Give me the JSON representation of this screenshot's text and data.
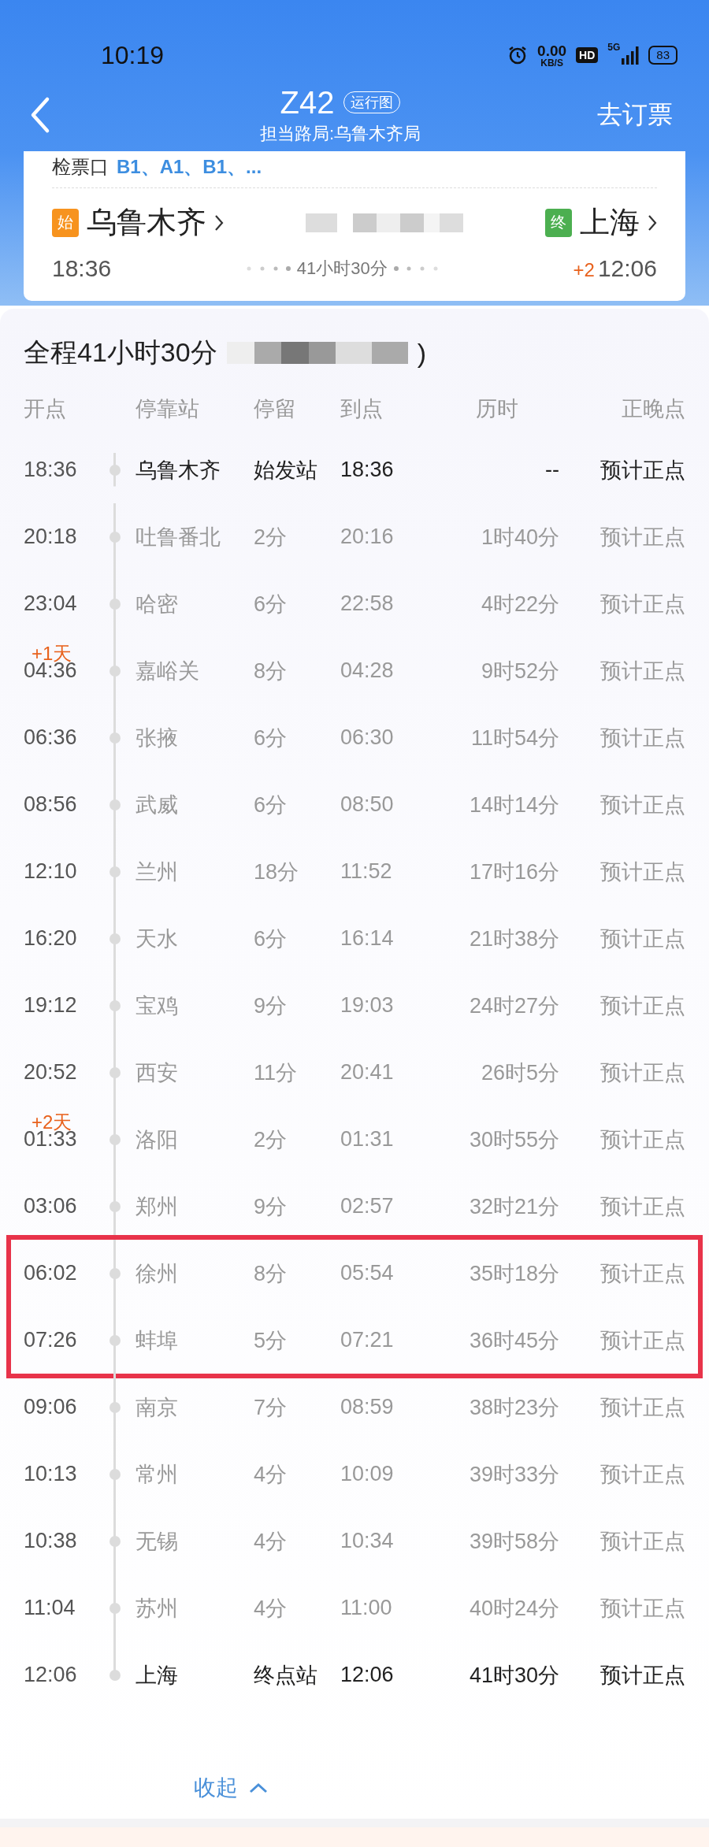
{
  "status_bar": {
    "time": "10:19",
    "speed": "0.00",
    "speed_unit": "KB/S",
    "hd": "HD",
    "network": "5G",
    "battery": "83"
  },
  "header": {
    "train": "Z42",
    "badge": "运行图",
    "subtitle": "担当路局:乌鲁木齐局",
    "action": "去订票"
  },
  "card": {
    "gate_label": "检票口",
    "gate_value": "B1、A1、B1、...",
    "origin": {
      "tag": "始",
      "station": "乌鲁木齐",
      "time": "18:36"
    },
    "terminal": {
      "tag": "终",
      "station": "上海",
      "time": "12:06",
      "day_offset": "+2"
    },
    "duration": "41小时30分"
  },
  "schedule": {
    "title": "全程41小时30分",
    "title_tail": ")",
    "columns": [
      "开点",
      "停靠站",
      "停留",
      "到点",
      "历时",
      "正晚点"
    ],
    "rows": [
      {
        "kind": "origin",
        "depart": "18:36",
        "station": "乌鲁木齐",
        "stop": "始发站",
        "arrive": "18:36",
        "elapsed": "--",
        "status": "预计正点",
        "highlighted": false
      },
      {
        "kind": "stop",
        "depart": "20:18",
        "station": "吐鲁番北",
        "stop": "2分",
        "arrive": "20:16",
        "elapsed": "1时40分",
        "status": "预计正点",
        "highlighted": false
      },
      {
        "kind": "stop",
        "depart": "23:04",
        "station": "哈密",
        "stop": "6分",
        "arrive": "22:58",
        "elapsed": "4时22分",
        "status": "预计正点",
        "highlighted": false
      },
      {
        "kind": "stop",
        "day_mark": "+1天",
        "depart": "04:36",
        "station": "嘉峪关",
        "stop": "8分",
        "arrive": "04:28",
        "elapsed": "9时52分",
        "status": "预计正点",
        "highlighted": false
      },
      {
        "kind": "stop",
        "depart": "06:36",
        "station": "张掖",
        "stop": "6分",
        "arrive": "06:30",
        "elapsed": "11时54分",
        "status": "预计正点",
        "highlighted": false
      },
      {
        "kind": "stop",
        "depart": "08:56",
        "station": "武威",
        "stop": "6分",
        "arrive": "08:50",
        "elapsed": "14时14分",
        "status": "预计正点",
        "highlighted": false
      },
      {
        "kind": "stop",
        "depart": "12:10",
        "station": "兰州",
        "stop": "18分",
        "arrive": "11:52",
        "elapsed": "17时16分",
        "status": "预计正点",
        "highlighted": false
      },
      {
        "kind": "stop",
        "depart": "16:20",
        "station": "天水",
        "stop": "6分",
        "arrive": "16:14",
        "elapsed": "21时38分",
        "status": "预计正点",
        "highlighted": false
      },
      {
        "kind": "stop",
        "depart": "19:12",
        "station": "宝鸡",
        "stop": "9分",
        "arrive": "19:03",
        "elapsed": "24时27分",
        "status": "预计正点",
        "highlighted": false
      },
      {
        "kind": "stop",
        "depart": "20:52",
        "station": "西安",
        "stop": "11分",
        "arrive": "20:41",
        "elapsed": "26时5分",
        "status": "预计正点",
        "highlighted": false
      },
      {
        "kind": "stop",
        "day_mark": "+2天",
        "depart": "01:33",
        "station": "洛阳",
        "stop": "2分",
        "arrive": "01:31",
        "elapsed": "30时55分",
        "status": "预计正点",
        "highlighted": false
      },
      {
        "kind": "stop",
        "depart": "03:06",
        "station": "郑州",
        "stop": "9分",
        "arrive": "02:57",
        "elapsed": "32时21分",
        "status": "预计正点",
        "highlighted": false
      },
      {
        "kind": "stop",
        "depart": "06:02",
        "station": "徐州",
        "stop": "8分",
        "arrive": "05:54",
        "elapsed": "35时18分",
        "status": "预计正点",
        "highlighted": true
      },
      {
        "kind": "stop",
        "depart": "07:26",
        "station": "蚌埠",
        "stop": "5分",
        "arrive": "07:21",
        "elapsed": "36时45分",
        "status": "预计正点",
        "highlighted": true
      },
      {
        "kind": "stop",
        "depart": "09:06",
        "station": "南京",
        "stop": "7分",
        "arrive": "08:59",
        "elapsed": "38时23分",
        "status": "预计正点",
        "highlighted": false
      },
      {
        "kind": "stop",
        "depart": "10:13",
        "station": "常州",
        "stop": "4分",
        "arrive": "10:09",
        "elapsed": "39时33分",
        "status": "预计正点",
        "highlighted": false
      },
      {
        "kind": "stop",
        "depart": "10:38",
        "station": "无锡",
        "stop": "4分",
        "arrive": "10:34",
        "elapsed": "39时58分",
        "status": "预计正点",
        "highlighted": false
      },
      {
        "kind": "stop",
        "depart": "11:04",
        "station": "苏州",
        "stop": "4分",
        "arrive": "11:00",
        "elapsed": "40时24分",
        "status": "预计正点",
        "highlighted": false
      },
      {
        "kind": "terminal",
        "depart": "12:06",
        "station": "上海",
        "stop": "终点站",
        "arrive": "12:06",
        "elapsed": "41时30分",
        "status": "预计正点",
        "highlighted": false
      }
    ],
    "collapse": "收起"
  }
}
